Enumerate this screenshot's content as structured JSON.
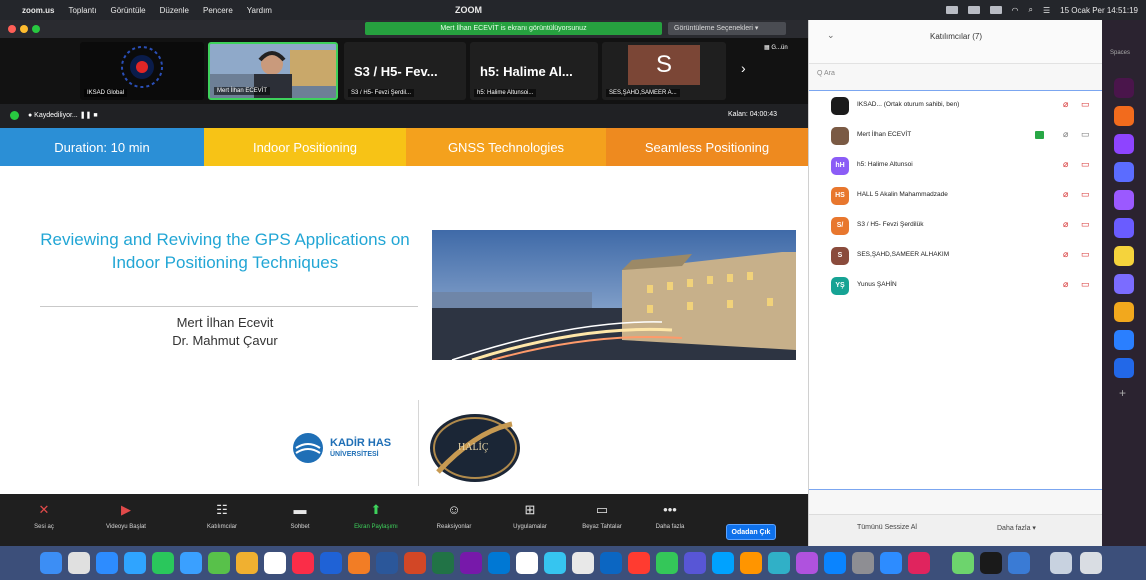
{
  "menubar": {
    "items": [
      "zoom.us",
      "Toplantı",
      "Görüntüle",
      "Düzenle",
      "Pencere",
      "Yardım"
    ],
    "center_label": "ZOOM",
    "clock": "15 Ocak Per 14:51:19"
  },
  "window": {
    "share_banner": "Mert İlhan ECEVİT is ekranı görüntülüyorsunuz",
    "share_options": "Görüntüleme Seçenekleri ▾"
  },
  "video_strip": {
    "tiles": [
      {
        "name": "IKSAD Global",
        "big": ""
      },
      {
        "name": "Mert İlhan ECEVİT",
        "big": ""
      },
      {
        "name": "S3 / H5- Fevzi Şerdil...",
        "big": "S3 / H5- Fev..."
      },
      {
        "name": "h5: Halime Altunsoi...",
        "big": "h5: Halime Al..."
      },
      {
        "name": "SES,ŞAHD,SAMEER A...",
        "big": "S"
      }
    ],
    "next_label": "›",
    "grid_label": "▦ G...ün",
    "recording_label": "● Kaydediliyor...  ❚❚  ■",
    "elapsed_label": "Kalan: 04:00:43"
  },
  "slide_tabs": [
    {
      "label": "Duration: 10 min",
      "color": "#2b8fd6"
    },
    {
      "label": "Indoor Positioning",
      "color": "#f7c316"
    },
    {
      "label": "GNSS Technologies",
      "color": "#f4a11d"
    },
    {
      "label": "Seamless Positioning",
      "color": "#ee8a1f"
    }
  ],
  "slide": {
    "title": "Reviewing and Reviving the GPS Applications on Indoor Positioning Techniques",
    "author1": "Mert İlhan Ecevit",
    "author2": "Dr. Mahmut Çavur",
    "logo1_line1": "KADİR HAS",
    "logo1_line2": "ÜNİVERSİTESİ",
    "logo2_text": "HALİÇ"
  },
  "toolbar": {
    "buttons": [
      {
        "label": "Sesi aç",
        "icon": "🎤"
      },
      {
        "label": "Videoyu Başlat",
        "icon": "📹"
      },
      {
        "label": "Katılımcılar",
        "icon": "👥"
      },
      {
        "label": "Sohbet",
        "icon": "💬"
      },
      {
        "label": "Ekran Paylaşımı",
        "icon": "⬆"
      },
      {
        "label": "Reaksiyonlar",
        "icon": "☺"
      },
      {
        "label": "Uygulamalar",
        "icon": "⊞"
      },
      {
        "label": "Beyaz Tahtalar",
        "icon": "▭"
      },
      {
        "label": "Daha fazla",
        "icon": "•••"
      }
    ],
    "end_label": "Odadan Çık"
  },
  "panel": {
    "title": "Katılımcılar (7)",
    "search_placeholder": "Q Ara",
    "participants": [
      {
        "initials": "",
        "name": "IKSAD... (Ortak oturum sahibi, ben)",
        "color": "#1b1b1b"
      },
      {
        "initials": "",
        "name": "Mert İlhan ECEVİT",
        "color": "#7a5a44"
      },
      {
        "initials": "hH",
        "name": "h5: Halime Altunsoi",
        "color": "#8b5cf6"
      },
      {
        "initials": "HS",
        "name": "HALL 5 Akalin Mahammadzade",
        "color": "#e8772e"
      },
      {
        "initials": "S/",
        "name": "S3 / H5- Fevzi Şerdilük",
        "color": "#e8772e"
      },
      {
        "initials": "S",
        "name": "SES,ŞAHD,SAMEER ALHAKIM",
        "color": "#8a4b3c"
      },
      {
        "initials": "YŞ",
        "name": "Yunus ŞAHİN",
        "color": "#16a394"
      }
    ],
    "footer_left": "Tümünü Sessize Al",
    "footer_right": "Daha fazla ▾"
  },
  "appbar": {
    "top_label": "Spaces"
  }
}
